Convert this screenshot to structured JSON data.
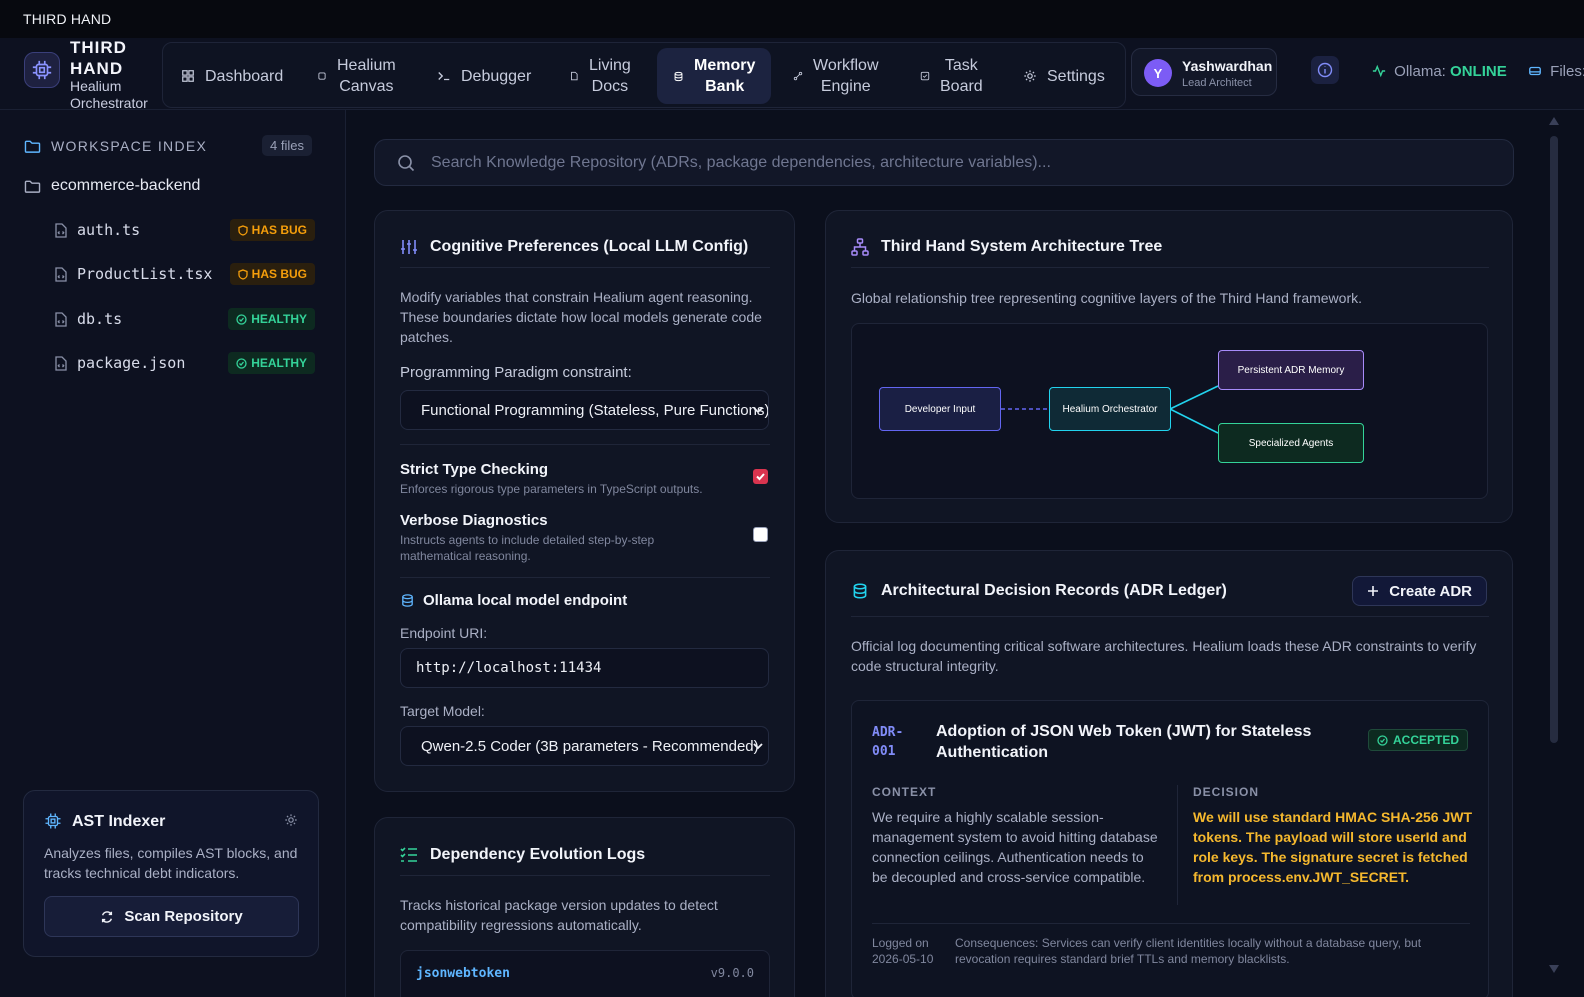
{
  "window": {
    "title": "THIRD HAND"
  },
  "brand": {
    "name_line1": "THIRD",
    "name_line2": "HAND",
    "sub_line1": "Healium",
    "sub_line2": "Orchestrator"
  },
  "nav": {
    "items": [
      {
        "label": "Dashboard",
        "icon": "grid-icon"
      },
      {
        "label_line1": "Healium",
        "label_line2": "Canvas",
        "icon": "cpu-icon"
      },
      {
        "label": "Debugger",
        "icon": "terminal-icon"
      },
      {
        "label_line1": "Living",
        "label_line2": "Docs",
        "icon": "document-icon"
      },
      {
        "label_line1": "Memory",
        "label_line2": "Bank",
        "icon": "database-icon",
        "active": true
      },
      {
        "label_line1": "Workflow",
        "label_line2": "Engine",
        "icon": "workflow-icon"
      },
      {
        "label_line1": "Task",
        "label_line2": "Board",
        "icon": "check-square-icon"
      },
      {
        "label": "Settings",
        "icon": "gear-icon"
      }
    ]
  },
  "user": {
    "initial": "Y",
    "name": "Yashwardhan",
    "role": "Lead Architect"
  },
  "status": {
    "ollama_label": "Ollama:",
    "ollama_value": "ONLINE",
    "files_label": "Files:"
  },
  "sidebar": {
    "workspace_title": "WORKSPACE INDEX",
    "file_count": "4 files",
    "folder": "ecommerce-backend",
    "files": [
      {
        "name": "auth.ts",
        "status": "HAS BUG"
      },
      {
        "name": "ProductList.tsx",
        "status": "HAS BUG"
      },
      {
        "name": "db.ts",
        "status": "HEALTHY"
      },
      {
        "name": "package.json",
        "status": "HEALTHY"
      }
    ],
    "ast": {
      "title": "AST Indexer",
      "description": "Analyzes files, compiles AST blocks, and tracks technical debt indicators.",
      "scan_label": "Scan Repository"
    }
  },
  "search": {
    "placeholder": "Search Knowledge Repository (ADRs, package dependencies, architecture variables)..."
  },
  "prefs": {
    "title": "Cognitive Preferences (Local LLM Config)",
    "description": "Modify variables that constrain Healium agent reasoning. These boundaries dictate how local models generate code patches.",
    "paradigm_label": "Programming Paradigm constraint:",
    "paradigm_value": "Functional Programming (Stateless, Pure Functions)",
    "strict_title": "Strict Type Checking",
    "strict_desc": "Enforces rigorous type parameters in TypeScript outputs.",
    "strict_checked": true,
    "verbose_title": "Verbose Diagnostics",
    "verbose_desc": "Instructs agents to include detailed step-by-step mathematical reasoning.",
    "verbose_checked": false,
    "ollama_title": "Ollama local model endpoint",
    "endpoint_label": "Endpoint URI:",
    "endpoint_value": "http://localhost:11434",
    "model_label": "Target Model:",
    "model_value": "Qwen-2.5 Coder (3B parameters - Recommended)"
  },
  "arch": {
    "title": "Third Hand System Architecture Tree",
    "description": "Global relationship tree representing cognitive layers of the Third Hand framework.",
    "nodes": {
      "developer": "Developer Input",
      "orchestrator": "Healium Orchestrator",
      "memory": "Persistent ADR Memory",
      "agents": "Specialized Agents"
    }
  },
  "adr": {
    "title": "Architectural Decision Records (ADR Ledger)",
    "create_label": "Create ADR",
    "description": "Official log documenting critical software architectures. Healium loads these ADR constraints to verify code structural integrity.",
    "record": {
      "id_line1": "ADR-",
      "id_line2": "001",
      "title": "Adoption of JSON Web Token (JWT) for Stateless Authentication",
      "status": "ACCEPTED",
      "context_label": "CONTEXT",
      "context": "We require a highly scalable session-management system to avoid hitting database connection ceilings. Authentication needs to be decoupled and cross-service compatible.",
      "decision_label": "DECISION",
      "decision": "We will use standard HMAC SHA-256 JWT tokens. The payload will store userId and role keys. The signature secret is fetched from process.env.JWT_SECRET.",
      "logged_label": "Logged on",
      "logged_date": "2026-05-10",
      "consequences": "Consequences: Services can verify client identities locally without a database query, but revocation requires standard brief TTLs and memory blacklists."
    }
  },
  "deps": {
    "title": "Dependency Evolution Logs",
    "description": "Tracks historical package version updates to detect compatibility regressions automatically.",
    "package": "jsonwebtoken",
    "version": "v9.0.0"
  },
  "colors": {
    "accent": "#818cf8",
    "healthy": "#34d399",
    "bug": "#f59e0b",
    "decision": "#f5b82e"
  }
}
